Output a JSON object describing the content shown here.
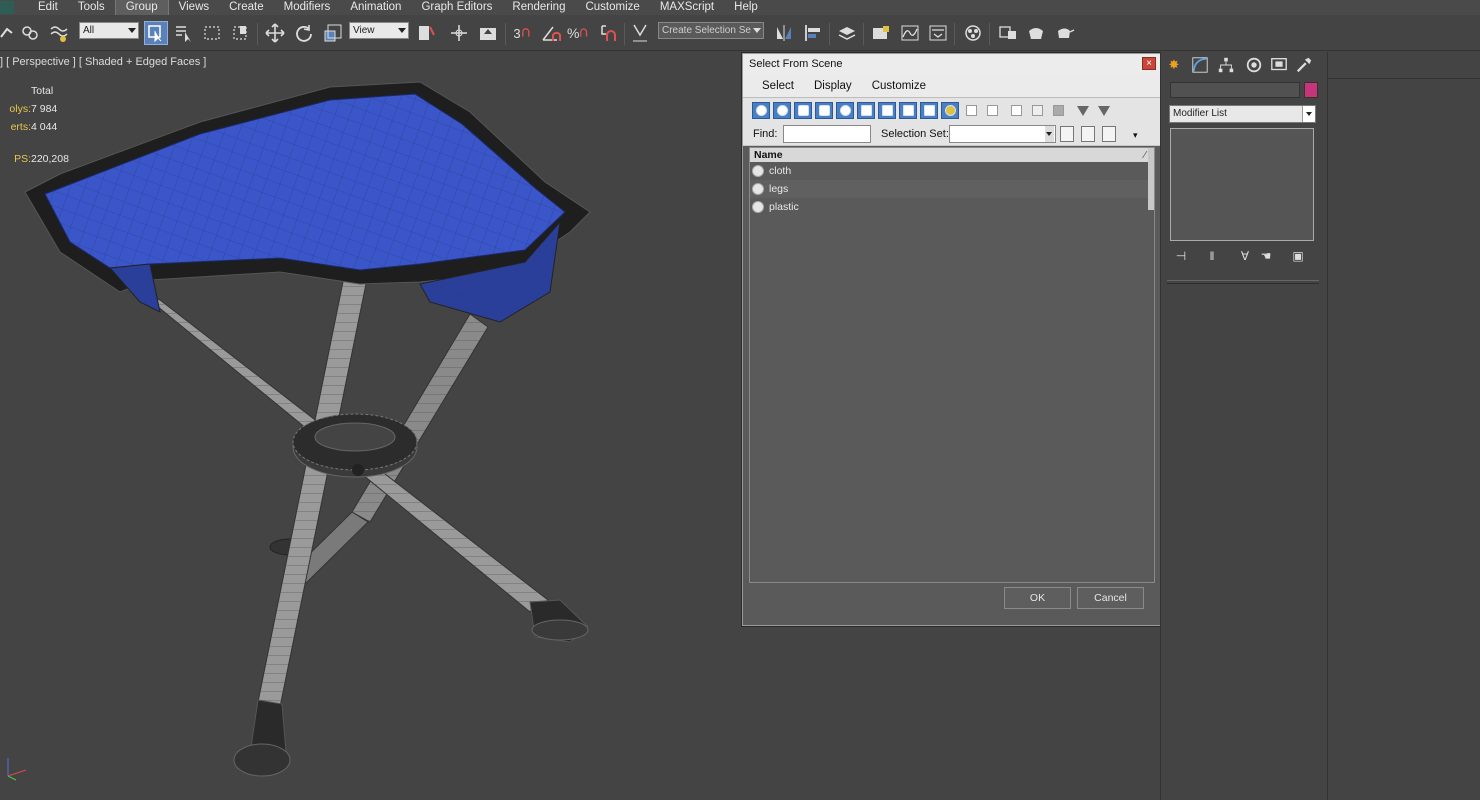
{
  "menu": {
    "items": [
      "Edit",
      "Tools",
      "Group",
      "Views",
      "Create",
      "Modifiers",
      "Animation",
      "Graph Editors",
      "Rendering",
      "Customize",
      "MAXScript",
      "Help"
    ],
    "active": "Group"
  },
  "toolbar": {
    "selection_filter": "All",
    "reference_coord": "View",
    "named_selection_placeholder": "Create Selection Se",
    "snap_angle_label": "3",
    "percent_label": "%"
  },
  "viewport": {
    "label": "] [ Perspective ] [ Shaded + Edged Faces ]",
    "stats_header": "Total",
    "stats": [
      {
        "key": "olys:",
        "value": "7 984"
      },
      {
        "key": "erts:",
        "value": "4 044"
      },
      {
        "key": "PS:",
        "value": "220,208"
      }
    ]
  },
  "dialog": {
    "title": "Select From Scene",
    "close_label": "×",
    "menu": [
      "Select",
      "Display",
      "Customize"
    ],
    "find_label": "Find:",
    "selection_set_label": "Selection Set:",
    "list_header": "Name",
    "objects": [
      {
        "name": "cloth"
      },
      {
        "name": "legs"
      },
      {
        "name": "plastic"
      }
    ],
    "ok_label": "OK",
    "cancel_label": "Cancel"
  },
  "command_panel": {
    "modifier_list": "Modifier List",
    "color_swatch": "#c8347a"
  },
  "colors": {
    "seat_blue": "#3a56c8",
    "legs_gray": "#8a8a8a",
    "accent": "#5a82b8"
  }
}
